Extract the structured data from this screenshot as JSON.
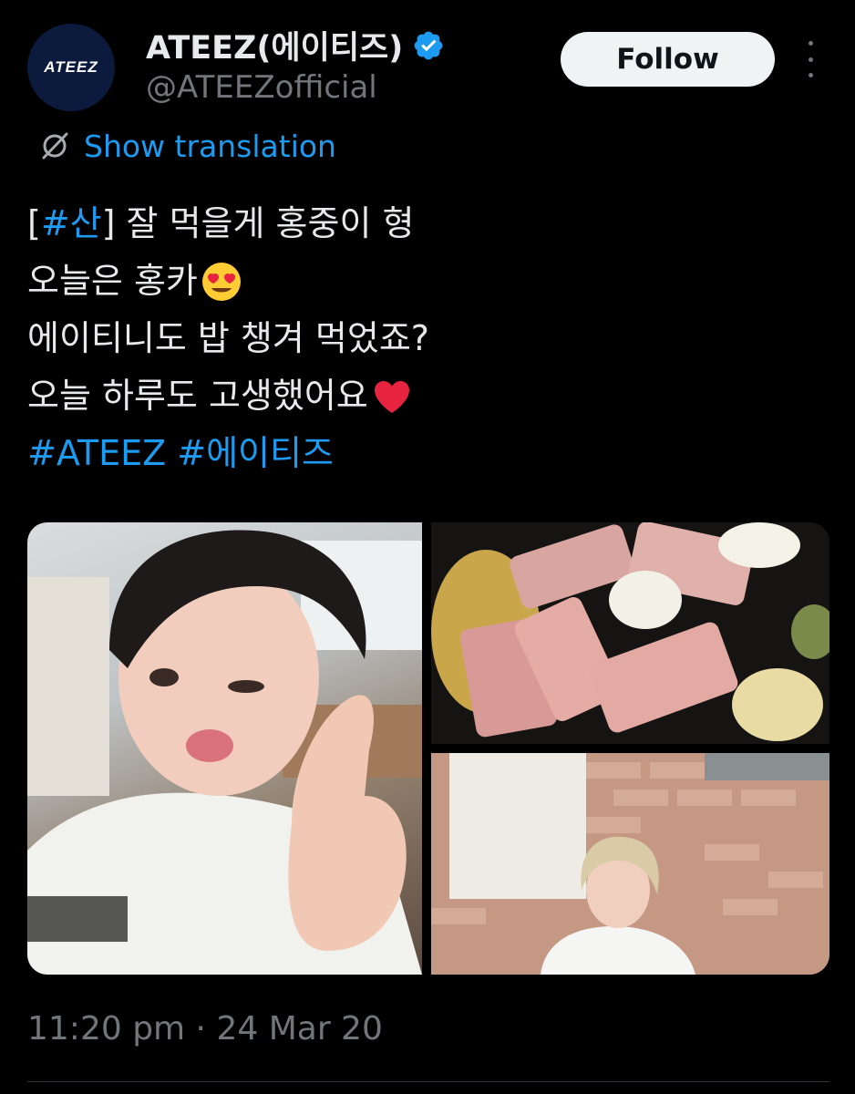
{
  "account": {
    "display_name": "ATEEZ(에이티즈)",
    "handle": "@ATEEZofficial",
    "avatar_text": "ATEEZ",
    "verified": true
  },
  "actions": {
    "follow_label": "Follow"
  },
  "translation": {
    "label": "Show translation"
  },
  "tweet": {
    "line1_open": "[",
    "line1_tag": "#산",
    "line1_rest": "] 잘 먹을게 홍중이 형",
    "line2": "오늘은 홍카",
    "line3": "에이티니도 밥 챙겨 먹었죠?",
    "line4": "오늘 하루도 고생했어요",
    "hashtag1": "#ATEEZ",
    "hashtag2": "#에이티즈"
  },
  "timestamp": "11:20 pm · 24 Mar 20",
  "colors": {
    "background": "#000000",
    "link": "#1d9bf0",
    "text": "#e7e9ea",
    "secondary": "#71767b",
    "follow_bg": "#eff3f4"
  },
  "icons": {
    "verified": "verified-badge-icon",
    "translate": "globe-translate-icon",
    "more": "more-vertical-icon",
    "emoji_line2": "heart-eyes-emoji-icon",
    "emoji_line4": "red-heart-emoji-icon"
  }
}
